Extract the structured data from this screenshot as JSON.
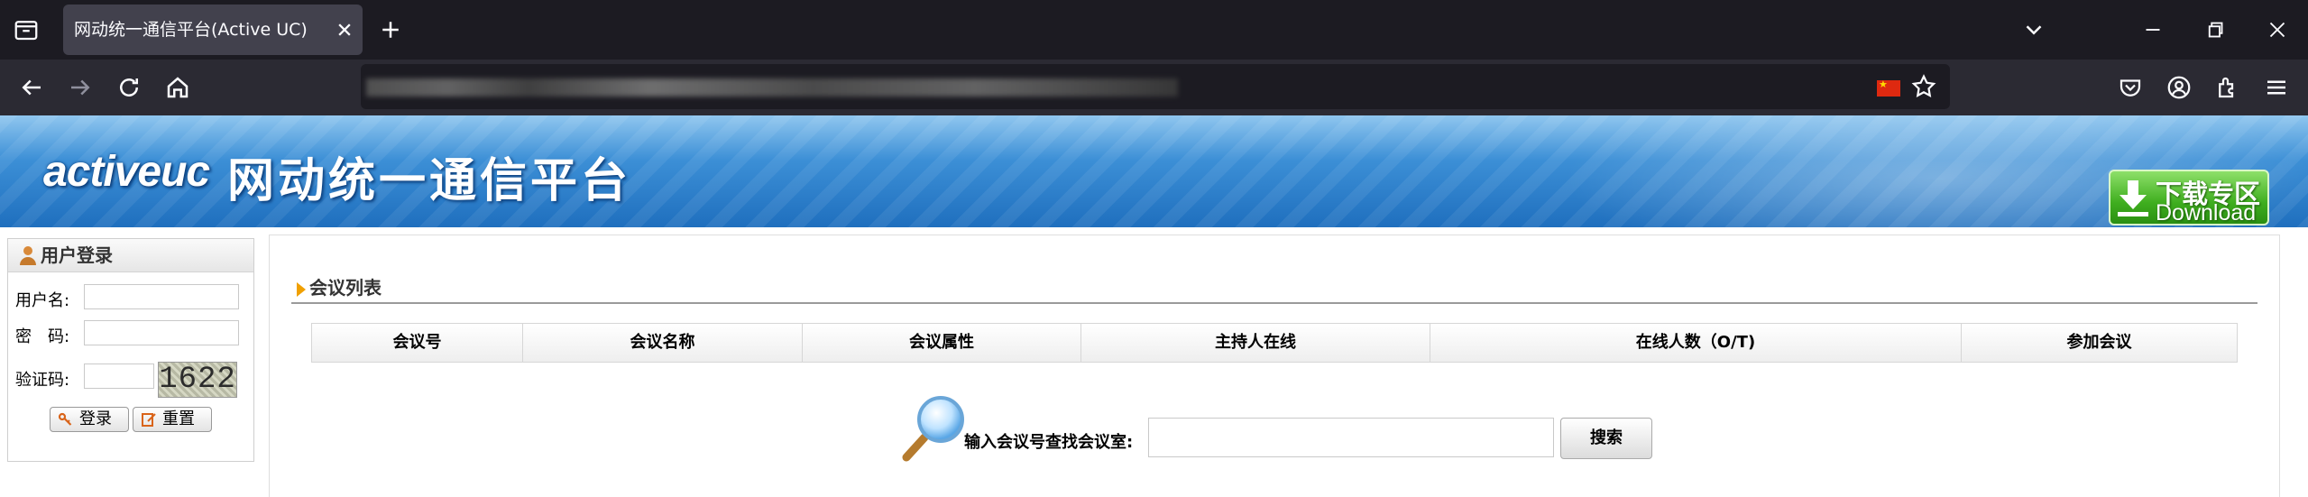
{
  "browser": {
    "tab_title": "网动统一通信平台(Active UC)",
    "url": ""
  },
  "banner": {
    "logo_text": "activeuc",
    "title": "网动统一通信平台",
    "download_cn": "下载专区",
    "download_en": "Download"
  },
  "login": {
    "title": "用户登录",
    "username_label": "用户名:",
    "password_label": "密　码:",
    "captcha_label": "验证码:",
    "captcha_value": "1622",
    "login_button": "登录",
    "reset_button": "重置"
  },
  "meeting_list": {
    "section_title": "会议列表",
    "columns": [
      "会议号",
      "会议名称",
      "会议属性",
      "主持人在线",
      "在线人数（O/T)",
      "参加会议"
    ],
    "search_label": "输入会议号查找会议室:",
    "search_button": "搜索"
  },
  "colors": {
    "banner_blue": "#1f6fbe",
    "download_green": "#3fae1f",
    "section_arrow": "#f0a000"
  }
}
